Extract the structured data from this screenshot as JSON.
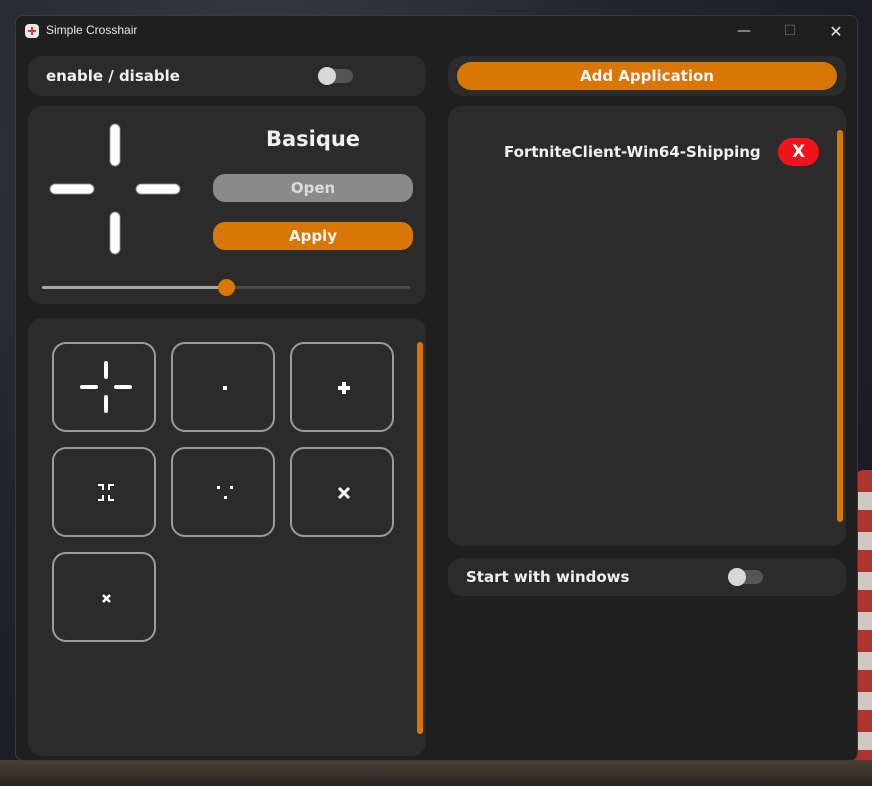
{
  "window": {
    "title": "Simple Crosshair",
    "min_glyph": "—",
    "max_glyph": "☐",
    "close_glyph": "✕"
  },
  "toggle": {
    "label": "enable / disable",
    "on": false
  },
  "preview": {
    "name": "Basique",
    "open_label": "Open",
    "apply_label": "Apply",
    "size_fraction": 0.5
  },
  "crosshairs": [
    {
      "name": "crosshair-gap-cross-icon"
    },
    {
      "name": "crosshair-dot-icon"
    },
    {
      "name": "crosshair-plus-icon"
    },
    {
      "name": "crosshair-corner-brackets-icon"
    },
    {
      "name": "crosshair-three-dots-icon"
    },
    {
      "name": "crosshair-x-icon"
    },
    {
      "name": "crosshair-small-x-icon"
    }
  ],
  "apps": {
    "add_label": "Add Application",
    "items": [
      {
        "name": "FortniteClient-Win64-Shipping",
        "remove_label": "X"
      }
    ]
  },
  "startup": {
    "label": "Start with windows",
    "on": false
  },
  "colors": {
    "accent": "#d97706",
    "remove": "#f0131a",
    "panel": "#2b2b2b",
    "background": "#1f1f1f"
  }
}
